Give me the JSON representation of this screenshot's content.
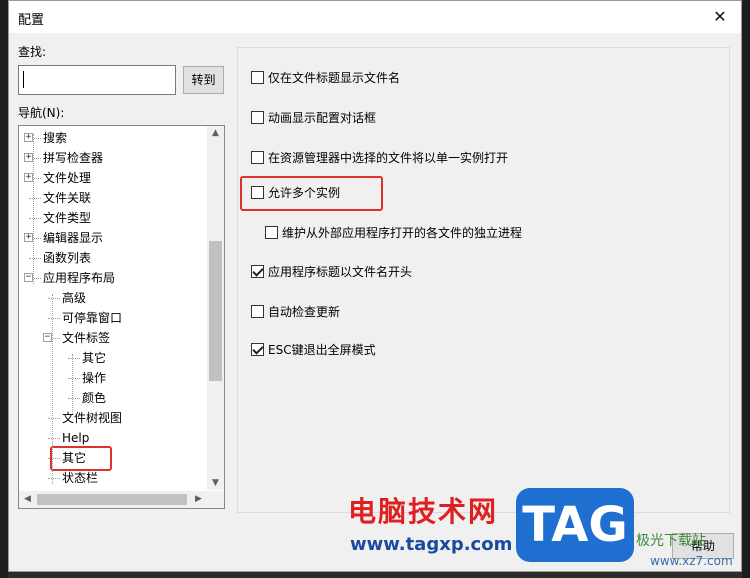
{
  "dialog": {
    "title": "配置",
    "close_glyph": "✕",
    "help_label": "帮助"
  },
  "search": {
    "label": "查找:",
    "value": "",
    "goto_label": "转到"
  },
  "nav": {
    "label": "导航(N):",
    "items": [
      {
        "label": "搜索",
        "level": 0,
        "expander": "+"
      },
      {
        "label": "拼写检查器",
        "level": 0,
        "expander": "+"
      },
      {
        "label": "文件处理",
        "level": 0,
        "expander": "+"
      },
      {
        "label": "文件关联",
        "level": 0,
        "expander": ""
      },
      {
        "label": "文件类型",
        "level": 0,
        "expander": ""
      },
      {
        "label": "编辑器显示",
        "level": 0,
        "expander": "+"
      },
      {
        "label": "函数列表",
        "level": 0,
        "expander": ""
      },
      {
        "label": "应用程序布局",
        "level": 0,
        "expander": "-"
      },
      {
        "label": "高级",
        "level": 1,
        "expander": ""
      },
      {
        "label": "可停靠窗口",
        "level": 1,
        "expander": ""
      },
      {
        "label": "文件标签",
        "level": 1,
        "expander": "-"
      },
      {
        "label": "其它",
        "level": 2,
        "expander": ""
      },
      {
        "label": "操作",
        "level": 2,
        "expander": ""
      },
      {
        "label": "颜色",
        "level": 2,
        "expander": ""
      },
      {
        "label": "文件树视图",
        "level": 1,
        "expander": ""
      },
      {
        "label": "Help",
        "level": 1,
        "expander": ""
      },
      {
        "label": "其它",
        "level": 1,
        "expander": "",
        "highlighted": true
      },
      {
        "label": "状态栏",
        "level": 1,
        "expander": ""
      }
    ]
  },
  "options": [
    {
      "label": "仅在文件标题显示文件名",
      "checked": false,
      "indent": false
    },
    {
      "label": "动画显示配置对话框",
      "checked": false,
      "indent": false
    },
    {
      "label": "在资源管理器中选择的文件将以单一实例打开",
      "checked": false,
      "indent": false
    },
    {
      "label": "允许多个实例",
      "checked": false,
      "indent": false,
      "highlighted": true
    },
    {
      "label": "维护从外部应用程序打开的各文件的独立进程",
      "checked": false,
      "indent": true
    },
    {
      "label": "应用程序标题以文件名开头",
      "checked": true,
      "indent": false
    },
    {
      "label": "自动检查更新",
      "checked": false,
      "indent": false
    },
    {
      "label": "ESC键退出全屏模式",
      "checked": true,
      "indent": false
    }
  ],
  "watermark": {
    "cn_text": "电脑技术网",
    "url": "www.tagxp.com",
    "logo": "TAG",
    "site": "极光下载站",
    "site_url": "www.xz7.com"
  },
  "colors": {
    "highlight": "#e03030",
    "dialog_bg": "#f0f0f0"
  }
}
